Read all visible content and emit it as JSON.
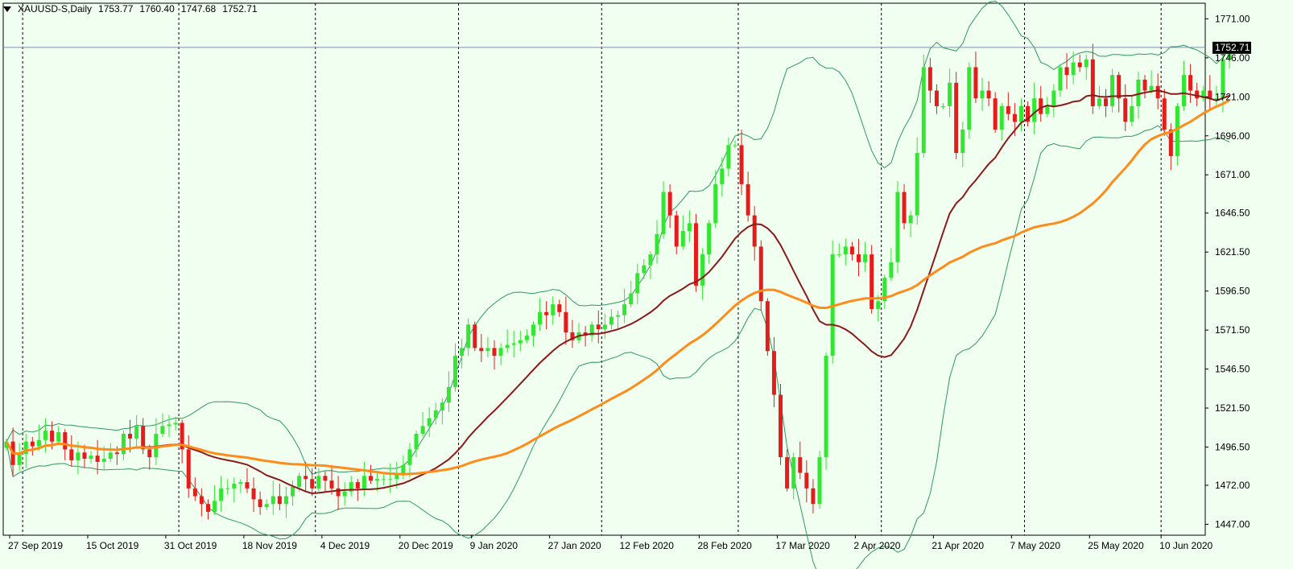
{
  "header": {
    "symbol": "XAUUSD-S,Daily",
    "open": "1753.77",
    "high": "1760.40",
    "low": "1747.68",
    "close": "1752.71"
  },
  "colors": {
    "background": "#f0fff0",
    "bull": "#32e632",
    "bear": "#e61c1c",
    "ma_fast": "#8b1a1a",
    "ma_slow": "#ff8c1a",
    "bands": "#2e9a5e",
    "grid": "#000000",
    "price_line": "#8090b0",
    "price_tag_bg": "#000000"
  },
  "chart_data": {
    "type": "candlestick",
    "symbol": "XAUUSD-S",
    "timeframe": "Daily",
    "current_price": 1752.71,
    "current_price_label": "1752.71",
    "ylim": [
      1440,
      1781
    ],
    "y_ticks": [
      "1771.00",
      "1746.00",
      "1721.00",
      "1696.00",
      "1671.00",
      "1646.50",
      "1621.50",
      "1596.50",
      "1571.50",
      "1546.50",
      "1521.50",
      "1496.50",
      "1472.00",
      "1447.00"
    ],
    "x_labels": [
      {
        "label": "27 Sep 2019",
        "index": 0
      },
      {
        "label": "15 Oct 2019",
        "index": 12
      },
      {
        "label": "31 Oct 2019",
        "index": 24
      },
      {
        "label": "18 Nov 2019",
        "index": 36
      },
      {
        "label": "4 Dec 2019",
        "index": 48
      },
      {
        "label": "20 Dec 2019",
        "index": 60
      },
      {
        "label": "9 Jan 2020",
        "index": 71
      },
      {
        "label": "27 Jan 2020",
        "index": 83
      },
      {
        "label": "12 Feb 2020",
        "index": 94
      },
      {
        "label": "28 Feb 2020",
        "index": 106
      },
      {
        "label": "17 Mar 2020",
        "index": 118
      },
      {
        "label": "2 Apr 2020",
        "index": 130
      },
      {
        "label": "21 Apr 2020",
        "index": 142
      },
      {
        "label": "7 May 2020",
        "index": 154
      },
      {
        "label": "25 May 2020",
        "index": 166
      },
      {
        "label": "10 Jun 2020",
        "index": 177
      }
    ],
    "separators": [
      2,
      26,
      47,
      69,
      91,
      112,
      134,
      156,
      177
    ],
    "closes": [
      1500,
      1485,
      1492,
      1500,
      1497,
      1501,
      1507,
      1500,
      1506,
      1495,
      1488,
      1493,
      1489,
      1491,
      1487,
      1489,
      1493,
      1492,
      1505,
      1502,
      1510,
      1495,
      1490,
      1505,
      1510,
      1511,
      1512,
      1495,
      1470,
      1465,
      1460,
      1455,
      1462,
      1470,
      1470,
      1473,
      1474,
      1470,
      1463,
      1458,
      1460,
      1465,
      1460,
      1465,
      1471,
      1478,
      1476,
      1470,
      1478,
      1475,
      1470,
      1465,
      1468,
      1474,
      1470,
      1478,
      1475,
      1476,
      1476,
      1476,
      1479,
      1485,
      1495,
      1505,
      1510,
      1515,
      1520,
      1525,
      1535,
      1555,
      1560,
      1575,
      1560,
      1558,
      1560,
      1555,
      1560,
      1562,
      1563,
      1565,
      1568,
      1575,
      1583,
      1581,
      1588,
      1583,
      1570,
      1565,
      1570,
      1568,
      1575,
      1572,
      1575,
      1580,
      1581,
      1588,
      1595,
      1608,
      1613,
      1620,
      1633,
      1660,
      1645,
      1625,
      1635,
      1640,
      1600,
      1620,
      1640,
      1665,
      1675,
      1690,
      1690,
      1665,
      1645,
      1625,
      1590,
      1558,
      1530,
      1490,
      1470,
      1490,
      1480,
      1470,
      1460,
      1490,
      1555,
      1620,
      1620,
      1625,
      1620,
      1615,
      1620,
      1585,
      1590,
      1605,
      1615,
      1660,
      1640,
      1645,
      1685,
      1740,
      1725,
      1715,
      1715,
      1730,
      1685,
      1700,
      1740,
      1720,
      1725,
      1720,
      1700,
      1715,
      1710,
      1705,
      1715,
      1705,
      1720,
      1710,
      1715,
      1725,
      1740,
      1735,
      1743,
      1740,
      1745,
      1715,
      1720,
      1715,
      1735,
      1720,
      1705,
      1715,
      1732,
      1725,
      1728,
      1720,
      1700,
      1683,
      1715,
      1735,
      1725,
      1720,
      1725,
      1720,
      1720,
      1745,
      1752.71
    ],
    "series": [
      {
        "name": "MA fast",
        "color": "#8b1a1a"
      },
      {
        "name": "MA slow",
        "color": "#ff8c1a"
      },
      {
        "name": "Bollinger bands",
        "color": "#2e9a5e"
      }
    ]
  }
}
